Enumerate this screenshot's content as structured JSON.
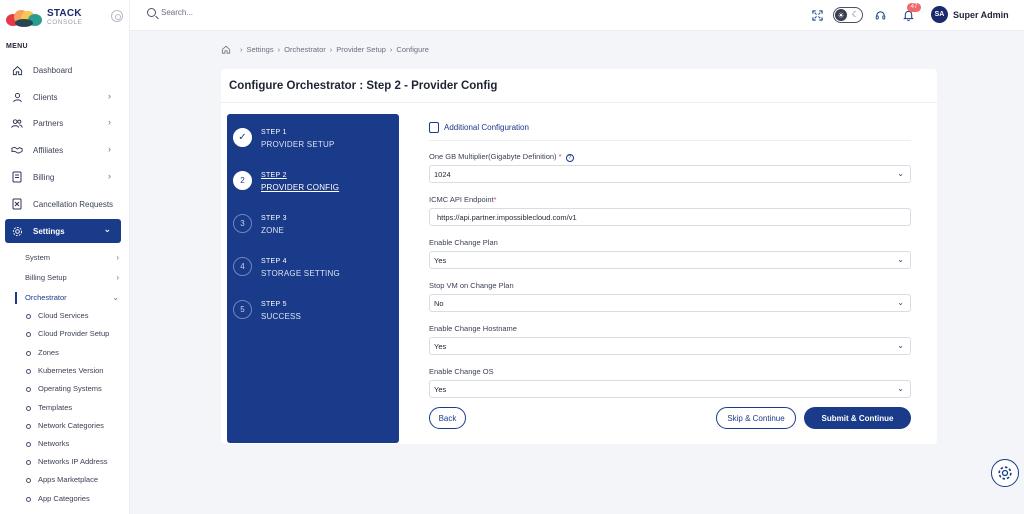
{
  "brand": {
    "name": "STACK",
    "sub": "CONSOLE"
  },
  "sidebar": {
    "menu_label": "MENU",
    "items": [
      {
        "label": "Dashboard",
        "icon": "home-icon"
      },
      {
        "label": "Clients",
        "icon": "user-icon",
        "chevron": "›"
      },
      {
        "label": "Partners",
        "icon": "users-icon",
        "chevron": "›"
      },
      {
        "label": "Affiliates",
        "icon": "handshake-icon",
        "chevron": "›"
      },
      {
        "label": "Billing",
        "icon": "document-icon",
        "chevron": "›"
      },
      {
        "label": "Cancellation Requests",
        "icon": "cancel-document-icon"
      },
      {
        "label": "Settings",
        "icon": "gear-icon",
        "chevron": "⌄",
        "active": true
      }
    ],
    "settings_sub": [
      {
        "label": "System",
        "chevron": "›"
      },
      {
        "label": "Billing Setup",
        "chevron": "›"
      },
      {
        "label": "Orchestrator",
        "chevron": "⌄"
      }
    ],
    "orchestrator_items": [
      "Cloud Services",
      "Cloud Provider Setup",
      "Zones",
      "Kubernetes Version",
      "Operating Systems",
      "Templates",
      "Network Categories",
      "Networks",
      "Networks IP Address",
      "Apps Marketplace",
      "App Categories"
    ]
  },
  "topbar": {
    "search_placeholder": "Search...",
    "notification_count": "47",
    "user_initials": "SA",
    "user_name": "Super Admin"
  },
  "breadcrumb": [
    "Settings",
    "Orchestrator",
    "Provider Setup",
    "Configure"
  ],
  "page": {
    "title": "Configure Orchestrator : Step 2 - Provider Config"
  },
  "steps": [
    {
      "num": "STEP 1",
      "name": "PROVIDER SETUP",
      "state": "done",
      "marker": "✓"
    },
    {
      "num": "STEP 2",
      "name": "PROVIDER CONFIG",
      "state": "current",
      "marker": "2"
    },
    {
      "num": "STEP 3",
      "name": "ZONE",
      "state": "pending",
      "marker": "3"
    },
    {
      "num": "STEP 4",
      "name": "STORAGE SETTING",
      "state": "pending",
      "marker": "4"
    },
    {
      "num": "STEP 5",
      "name": "SUCCESS",
      "state": "pending",
      "marker": "5"
    }
  ],
  "form": {
    "section_title": "Additional Configuration",
    "fields": [
      {
        "label": "One GB Multiplier(Gigabyte Definition)",
        "required": true,
        "help": true,
        "type": "select",
        "value": "1024"
      },
      {
        "label": "ICMC API Endpoint",
        "required": true,
        "type": "input",
        "value": "https://api.partner.impossiblecloud.com/v1"
      },
      {
        "label": "Enable Change Plan",
        "type": "select",
        "value": "Yes"
      },
      {
        "label": "Stop VM on Change Plan",
        "type": "select",
        "value": "No"
      },
      {
        "label": "Enable Change Hostname",
        "type": "select",
        "value": "Yes"
      },
      {
        "label": "Enable Change OS",
        "type": "select",
        "value": "Yes"
      }
    ],
    "buttons": {
      "back": "Back",
      "skip": "Skip & Continue",
      "submit": "Submit & Continue"
    }
  },
  "colors": {
    "primary": "#1a3a8a",
    "required": "#e04848",
    "badge": "#f06a6a"
  }
}
